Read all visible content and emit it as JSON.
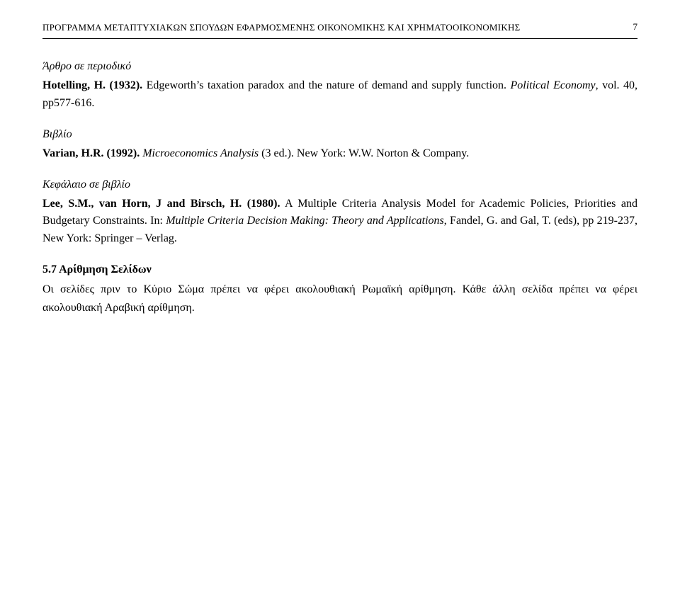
{
  "header": {
    "title": "ΠΡΟΓΡΑΜΜΑ ΜΕΤΑΠΤΥΧΙΑΚΩΝ ΣΠΟΥΔΩΝ ΕΦΑΡΜΟΣΜΕΝΗΣ ΟΙΚΟΝΟΜΙΚΗΣ ΚΑΙ ΧΡΗΜΑΤΟΟΙΚΟΝΟΜΙΚΗΣ",
    "page_number": "7"
  },
  "sections": {
    "article_label": "Άρθρο σε περιοδικό",
    "article_ref": {
      "author_year": "Hotelling, H. (1932).",
      "text": " Edgeworth’s taxation paradox and the nature of demand and supply function. ",
      "journal": "Political Economy",
      "rest": ", vol. 40, pp577-616."
    },
    "book_label": "Βιβλίο",
    "book_ref": {
      "author_year": "Varian, H.R. (1992).",
      "text_italic": " Microeconomics Analysis",
      "text_rest": " (3 ed.). New York: W.W. Norton & Company."
    },
    "chapter_label": "Κεφάλαιο σε βιβλίο",
    "chapter_ref": {
      "author_year": "Lee, S.M., van Horn, J and Birsch, H. (1980).",
      "text": " A Multiple Criteria Analysis Model for Academic Policies, Priorities and Budgetary Constraints. In: ",
      "book_italic": "Multiple Criteria Decision Making: Theory and Applications",
      "rest": ", Fandel, G. and Gal, T. (eds), pp 219-237, New York: Springer – Verlag."
    },
    "section_heading": "5.7 Αρίθμηση Σελίδων",
    "section_body_1": "Οι σελίδες πριν το Κύριο Σώμα πρέπει να φέρει ακολουθιακή Ρωμαϊκή αρίθμηση. Κάθε άλλη σελίδα πρέπει να φέρει ακολουθιακή Αραβική αρίθμηση."
  }
}
